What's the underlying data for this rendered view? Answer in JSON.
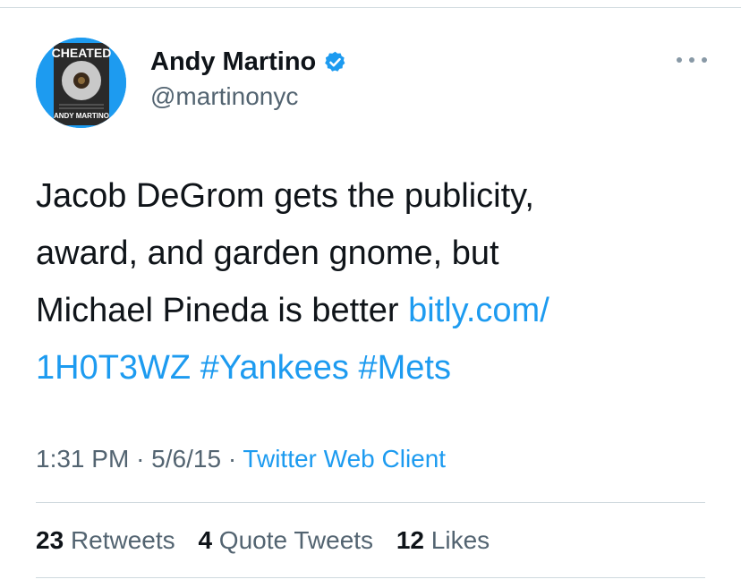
{
  "author": {
    "display_name": "Andy Martino",
    "handle": "@martinonyc",
    "avatar": {
      "title": "CHEATED",
      "name": "ANDY MARTINO",
      "color": "#1d9bf0"
    }
  },
  "tweet": {
    "text_parts": [
      "Jacob DeGrom gets the publicity,",
      "award, and garden gnome, but",
      "Michael Pineda is better "
    ],
    "link_part1": "bitly.com/",
    "link_part2": "1H0T3WZ",
    "hashtag1": "#Yankees",
    "hashtag2": "#Mets"
  },
  "meta": {
    "time": "1:31 PM",
    "date": "5/6/15",
    "separator": "·",
    "client": "Twitter Web Client"
  },
  "stats": {
    "retweets_count": "23",
    "retweets_label": "Retweets",
    "quotes_count": "4",
    "quotes_label": "Quote Tweets",
    "likes_count": "12",
    "likes_label": "Likes"
  },
  "colors": {
    "accent": "#1d9bf0",
    "secondary_text": "#536471",
    "primary_text": "#0f1419"
  },
  "icons": [
    "verified-badge-icon",
    "more-options-icon"
  ]
}
